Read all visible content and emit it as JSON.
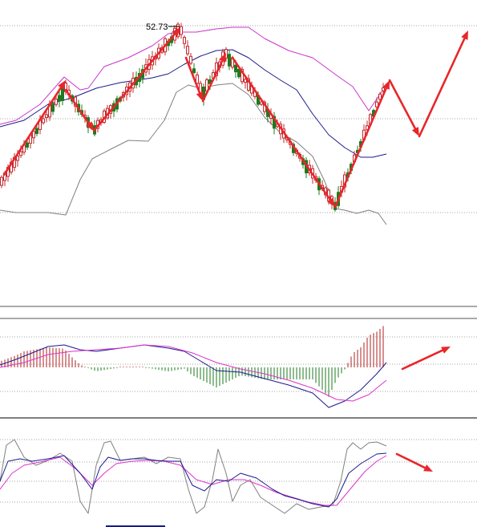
{
  "colors": {
    "background": "#ffffff",
    "grid": "#888888",
    "panel_border": "#555555",
    "candle_up": "#c0282d",
    "candle_down": "#1e7a1e",
    "ma_line": "#1a1a8c",
    "boll_upper": "#cc33cc",
    "boll_lower": "#808080",
    "arrow": "#e8262b",
    "macd_hist_pos": "#b02020",
    "macd_hist_neg": "#1e7a1e",
    "dif_line": "#1a1a8c",
    "dea_line": "#dd33cc",
    "k_line": "#1a1a8c",
    "d_line": "#dd33cc",
    "j_line": "#808080",
    "scrollbar": "#1a1a8c"
  },
  "chart_data": [
    {
      "type": "candlestick",
      "title": "",
      "annotations": [
        {
          "text": "52.73",
          "target": "period_high"
        }
      ],
      "series": [
        {
          "role": "candles",
          "count": 120
        },
        {
          "role": "ma",
          "curve": [
            [
              0,
              158
            ],
            [
              30,
              150
            ],
            [
              60,
              130
            ],
            [
              90,
              122
            ],
            [
              120,
              110
            ],
            [
              150,
              103
            ],
            [
              190,
              97
            ],
            [
              210,
              92
            ],
            [
              230,
              80
            ],
            [
              250,
              70
            ],
            [
              270,
              63
            ],
            [
              290,
              62
            ],
            [
              310,
              72
            ],
            [
              330,
              87
            ],
            [
              350,
              100
            ],
            [
              370,
              112
            ],
            [
              390,
              142
            ],
            [
              410,
              168
            ],
            [
              430,
              184
            ],
            [
              450,
              196
            ],
            [
              465,
              196
            ],
            [
              482,
              192
            ]
          ]
        },
        {
          "role": "boll_upper",
          "curve": [
            [
              0,
              155
            ],
            [
              20,
              150
            ],
            [
              50,
              130
            ],
            [
              80,
              96
            ],
            [
              100,
              112
            ],
            [
              110,
              110
            ],
            [
              130,
              83
            ],
            [
              160,
              72
            ],
            [
              190,
              57
            ],
            [
              210,
              42
            ],
            [
              225,
              40
            ],
            [
              245,
              40
            ],
            [
              270,
              36
            ],
            [
              290,
              34
            ],
            [
              310,
              34
            ],
            [
              330,
              48
            ],
            [
              360,
              63
            ],
            [
              390,
              72
            ],
            [
              420,
              94
            ],
            [
              440,
              108
            ],
            [
              460,
              138
            ],
            [
              475,
              116
            ],
            [
              482,
              104
            ]
          ]
        },
        {
          "role": "boll_lower",
          "curve": [
            [
              0,
              262
            ],
            [
              20,
              265
            ],
            [
              60,
              265
            ],
            [
              82,
              268
            ],
            [
              100,
              224
            ],
            [
              115,
              198
            ],
            [
              140,
              185
            ],
            [
              160,
              175
            ],
            [
              185,
              176
            ],
            [
              205,
              150
            ],
            [
              220,
              115
            ],
            [
              235,
              106
            ],
            [
              250,
              110
            ],
            [
              270,
              106
            ],
            [
              290,
              104
            ],
            [
              310,
              118
            ],
            [
              330,
              146
            ],
            [
              350,
              166
            ],
            [
              370,
              177
            ],
            [
              390,
              195
            ],
            [
              405,
              226
            ],
            [
              418,
              260
            ],
            [
              430,
              262
            ],
            [
              445,
              266
            ],
            [
              460,
              262
            ],
            [
              472,
              266
            ],
            [
              482,
              280
            ]
          ]
        }
      ],
      "arrows": [
        {
          "from": [
            5,
            218
          ],
          "to": [
            82,
            100
          ]
        },
        {
          "from": [
            82,
            112
          ],
          "to": [
            117,
            163
          ]
        },
        {
          "from": [
            117,
            163
          ],
          "to": [
            225,
            34
          ]
        },
        {
          "from": [
            232,
            72
          ],
          "to": [
            253,
            126
          ]
        },
        {
          "from": [
            253,
            126
          ],
          "to": [
            282,
            66
          ]
        },
        {
          "from": [
            290,
            72
          ],
          "to": [
            418,
            258
          ]
        },
        {
          "from": [
            418,
            258
          ],
          "to": [
            486,
            100
          ]
        },
        {
          "from": [
            486,
            100
          ],
          "to": [
            523,
            170
          ]
        },
        {
          "from": [
            523,
            170
          ],
          "to": [
            584,
            38
          ]
        }
      ]
    },
    {
      "type": "macd",
      "title": "",
      "series": [
        {
          "name": "",
          "role": "dif",
          "curve": [
            [
              0,
              455
            ],
            [
              20,
              448
            ],
            [
              40,
              440
            ],
            [
              60,
              432
            ],
            [
              80,
              430
            ],
            [
              100,
              436
            ],
            [
              120,
              438
            ],
            [
              150,
              434
            ],
            [
              180,
              430
            ],
            [
              210,
              434
            ],
            [
              230,
              438
            ],
            [
              250,
              450
            ],
            [
              270,
              462
            ],
            [
              300,
              464
            ],
            [
              330,
              472
            ],
            [
              360,
              480
            ],
            [
              390,
              490
            ],
            [
              410,
              508
            ],
            [
              430,
              500
            ],
            [
              450,
              486
            ],
            [
              470,
              466
            ],
            [
              482,
              452
            ]
          ]
        },
        {
          "name": "",
          "role": "dea",
          "curve": [
            [
              0,
              458
            ],
            [
              30,
              452
            ],
            [
              60,
              442
            ],
            [
              90,
              438
            ],
            [
              120,
              436
            ],
            [
              150,
              434
            ],
            [
              180,
              430
            ],
            [
              210,
              432
            ],
            [
              240,
              440
            ],
            [
              270,
              452
            ],
            [
              300,
              460
            ],
            [
              330,
              466
            ],
            [
              360,
              474
            ],
            [
              390,
              484
            ],
            [
              420,
              498
            ],
            [
              440,
              500
            ],
            [
              460,
              492
            ],
            [
              482,
              474
            ]
          ]
        },
        {
          "name": "",
          "role": "histogram",
          "count": 120
        }
      ],
      "annotations": [
        {
          "arrow": {
            "from": [
              502,
              460
            ],
            "to": [
              562,
              432
            ]
          }
        }
      ]
    },
    {
      "type": "kdj",
      "title": "",
      "series": [
        {
          "name": "",
          "role": "k",
          "curve": [
            [
              0,
              600
            ],
            [
              10,
              575
            ],
            [
              25,
              572
            ],
            [
              40,
              575
            ],
            [
              60,
              572
            ],
            [
              80,
              568
            ],
            [
              100,
              590
            ],
            [
              115,
              610
            ],
            [
              125,
              582
            ],
            [
              135,
              570
            ],
            [
              150,
              574
            ],
            [
              165,
              572
            ],
            [
              180,
              572
            ],
            [
              195,
              574
            ],
            [
              210,
              575
            ],
            [
              225,
              575
            ],
            [
              240,
              605
            ],
            [
              255,
              612
            ],
            [
              270,
              598
            ],
            [
              285,
              600
            ],
            [
              300,
              590
            ],
            [
              320,
              596
            ],
            [
              340,
              610
            ],
            [
              355,
              618
            ],
            [
              370,
              622
            ],
            [
              390,
              628
            ],
            [
              410,
              632
            ],
            [
              420,
              622
            ],
            [
              435,
              590
            ],
            [
              450,
              578
            ],
            [
              470,
              566
            ],
            [
              482,
              565
            ]
          ]
        },
        {
          "name": "",
          "role": "d",
          "curve": [
            [
              0,
              610
            ],
            [
              15,
              590
            ],
            [
              30,
              580
            ],
            [
              50,
              576
            ],
            [
              75,
              570
            ],
            [
              95,
              585
            ],
            [
              115,
              605
            ],
            [
              130,
              590
            ],
            [
              145,
              578
            ],
            [
              165,
              575
            ],
            [
              185,
              574
            ],
            [
              205,
              575
            ],
            [
              225,
              580
            ],
            [
              245,
              598
            ],
            [
              265,
              604
            ],
            [
              285,
              598
            ],
            [
              305,
              598
            ],
            [
              325,
              605
            ],
            [
              345,
              614
            ],
            [
              365,
              620
            ],
            [
              385,
              626
            ],
            [
              405,
              630
            ],
            [
              420,
              630
            ],
            [
              435,
              612
            ],
            [
              455,
              588
            ],
            [
              470,
              575
            ],
            [
              482,
              568
            ]
          ]
        },
        {
          "name": "",
          "role": "j",
          "curve": [
            [
              0,
              600
            ],
            [
              8,
              555
            ],
            [
              18,
              548
            ],
            [
              30,
              570
            ],
            [
              45,
              580
            ],
            [
              60,
              574
            ],
            [
              75,
              565
            ],
            [
              90,
              575
            ],
            [
              100,
              625
            ],
            [
              110,
              640
            ],
            [
              120,
              580
            ],
            [
              130,
              552
            ],
            [
              138,
              550
            ],
            [
              150,
              574
            ],
            [
              165,
              572
            ],
            [
              180,
              570
            ],
            [
              195,
              578
            ],
            [
              210,
              570
            ],
            [
              225,
              572
            ],
            [
              235,
              610
            ],
            [
              245,
              640
            ],
            [
              255,
              632
            ],
            [
              265,
              598
            ],
            [
              272,
              560
            ],
            [
              282,
              590
            ],
            [
              290,
              625
            ],
            [
              300,
              605
            ],
            [
              312,
              598
            ],
            [
              325,
              620
            ],
            [
              340,
              630
            ],
            [
              355,
              640
            ],
            [
              370,
              628
            ],
            [
              385,
              635
            ],
            [
              400,
              632
            ],
            [
              415,
              630
            ],
            [
              425,
              600
            ],
            [
              433,
              560
            ],
            [
              440,
              552
            ],
            [
              450,
              560
            ],
            [
              460,
              552
            ],
            [
              470,
              551
            ],
            [
              482,
              556
            ]
          ]
        }
      ],
      "annotations": [
        {
          "arrow": {
            "from": [
              495,
              566
            ],
            "to": [
              540,
              588
            ]
          }
        }
      ]
    }
  ]
}
